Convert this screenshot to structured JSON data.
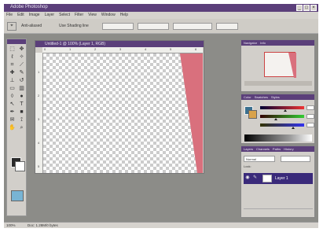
{
  "window": {
    "title": "Adobe Photoshop",
    "minimize": "_",
    "maximize": "□",
    "close": "×"
  },
  "menu": [
    "File",
    "Edit",
    "Image",
    "Layer",
    "Select",
    "Filter",
    "View",
    "Window",
    "Help"
  ],
  "options_bar": {
    "anti_aliased_label": "Anti-aliased",
    "feather_label": "Use Shading line"
  },
  "document": {
    "title": "Untitled-1 @ 100% (Layer 1, RGB)"
  },
  "ruler": {
    "h_ticks": [
      "0",
      "1",
      "2",
      "3",
      "4",
      "5",
      "6"
    ],
    "v_ticks": [
      "1",
      "2",
      "3",
      "4",
      "5"
    ]
  },
  "panels": {
    "navigator_tabs": [
      "Navigator",
      "Info"
    ],
    "color_tabs": [
      "Color",
      "Swatches",
      "Styles"
    ],
    "layers_tabs": [
      "Layers",
      "Channels",
      "Paths",
      "History"
    ],
    "blend_mode": "Normal",
    "lock_label": "Lock:",
    "layer_name": "Layer 1"
  },
  "colors": {
    "accent": "#5b3f7a",
    "shape": "#d9707d",
    "layer_highlight": "#3a2a7a"
  },
  "statusbar": {
    "zoom": "100%",
    "doc_size": "Doc: 1.28M/0 bytes"
  }
}
